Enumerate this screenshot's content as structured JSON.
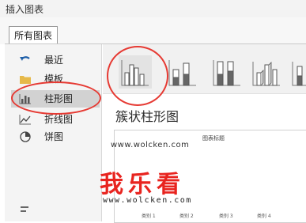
{
  "window": {
    "title": "插入图表"
  },
  "tabs": [
    {
      "label": "所有图表"
    }
  ],
  "sidebar": {
    "items": [
      {
        "label": "最近",
        "icon": "undo-arrow-icon"
      },
      {
        "label": "模板",
        "icon": "folder-icon"
      },
      {
        "label": "柱形图",
        "icon": "column-chart-icon",
        "selected": true
      },
      {
        "label": "折线图",
        "icon": "line-chart-icon"
      },
      {
        "label": "饼图",
        "icon": "pie-chart-icon"
      }
    ]
  },
  "main": {
    "subtypes": [
      {
        "icon": "clustered-column-icon",
        "selected": true
      },
      {
        "icon": "stacked-column-icon"
      },
      {
        "icon": "100-stacked-column-icon"
      },
      {
        "icon": "3d-clustered-column-icon"
      },
      {
        "icon": "3d-stacked-column-icon"
      }
    ],
    "subtype_title": "簇状柱形图",
    "preview": {
      "title": "图表标题",
      "categories": [
        "类别 1",
        "类别 2",
        "类别 3",
        "类别 4"
      ]
    }
  },
  "watermark": {
    "url_top": "www.wolcken.com",
    "brand": "我乐看",
    "url_bottom": "www.wolcken.com"
  },
  "colors": {
    "highlight": "#e63a33",
    "watermark_brand": "#e8241f"
  }
}
